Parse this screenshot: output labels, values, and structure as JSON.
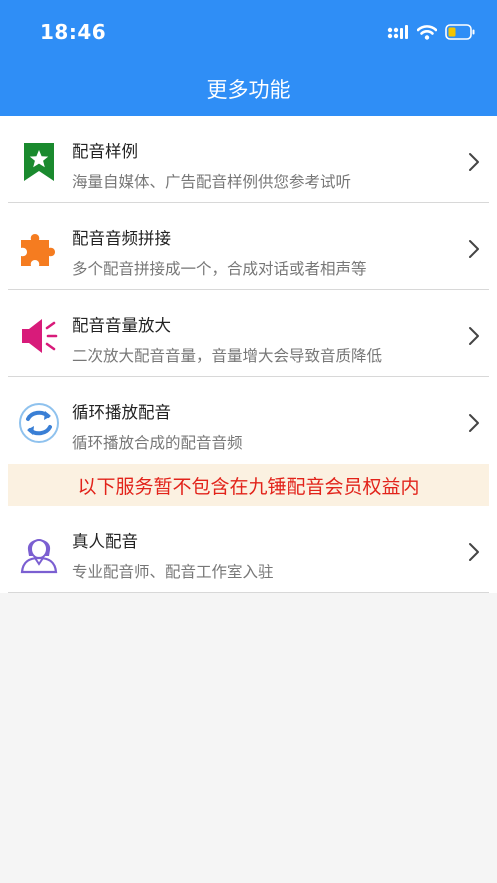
{
  "status_bar": {
    "time": "18:46",
    "icons": [
      "signal-icon",
      "wifi-icon",
      "battery-icon"
    ],
    "battery_color": "#f4c400"
  },
  "header": {
    "title": "更多功能",
    "background": "#2f8ef6"
  },
  "items": [
    {
      "title": "配音样例",
      "subtitle": "海量自媒体、广告配音样例供您参考试听",
      "icon": "bookmark-star-icon",
      "icon_color": "#1a8a2e"
    },
    {
      "title": "配音音频拼接",
      "subtitle": "多个配音拼接成一个，合成对话或者相声等",
      "icon": "puzzle-icon",
      "icon_color": "#f57c20"
    },
    {
      "title": "配音音量放大",
      "subtitle": "二次放大配音音量，音量增大会导致音质降低",
      "icon": "speaker-icon",
      "icon_color": "#d81b7a"
    },
    {
      "title": "循环播放配音",
      "subtitle": "循环播放合成的配音音频",
      "icon": "loop-icon",
      "icon_color": "#3a7fd5"
    }
  ],
  "notice": {
    "text": "以下服务暂不包含在九锤配音会员权益内",
    "color": "#e2231a",
    "background": "#fbf1e1"
  },
  "extra_items": [
    {
      "title": "真人配音",
      "subtitle": "专业配音师、配音工作室入驻",
      "icon": "person-icon",
      "icon_color": "#7b5fd1"
    }
  ]
}
